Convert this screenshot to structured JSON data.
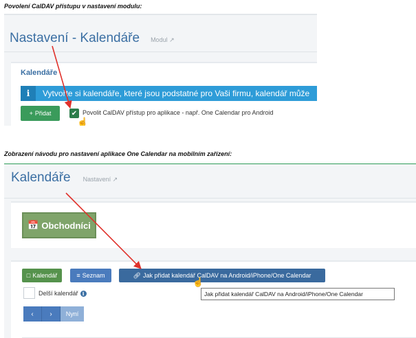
{
  "captions": {
    "first": "Povolení CalDAV přístupu v nastavení modulu:",
    "second": "Zobrazení návodu pro nastavení aplikace One Calendar na mobilním zařízení:"
  },
  "settings_screen": {
    "title": "Nastavení - Kalendáře",
    "module_link": "Modul",
    "section_title": "Kalendáře",
    "alert_text": "Vytvořte si kalendáře, které jsou podstatné pro Vaši firmu, kalendář může",
    "add_button": "Přidat",
    "caldav_checkbox_label": "Povolit CalDAV přístup pro aplikace - např. One Calendar pro Android",
    "caldav_checked": true
  },
  "calendar_screen": {
    "title": "Kalendáře",
    "settings_link": "Nastavení",
    "calendar_tile": "Obchodníci",
    "buttons": {
      "calendar": "Kalendář",
      "list": "Seznam",
      "how_to": "Jak přidat kalendář CalDAV na Android/iPhone/One Calendar"
    },
    "tooltip": "Jak přidat kalendář CalDAV na Android/iPhone/One Calendar",
    "longer_calendar_label": "Delší kalendář",
    "nav": {
      "prev": "‹",
      "next": "›",
      "now": "Nyní"
    }
  },
  "colors": {
    "accent_blue": "#3b6fa3",
    "alert_blue": "#2e9cd8",
    "success_green": "#3a9b5b",
    "arrow_red": "#e0312b"
  },
  "icons": [
    "external-link-icon",
    "info-icon",
    "plus-icon",
    "check-icon",
    "hand-cursor-icon",
    "calendar-icon",
    "list-icon",
    "link-icon",
    "chevron-left-icon",
    "chevron-right-icon",
    "info-circle-icon"
  ]
}
